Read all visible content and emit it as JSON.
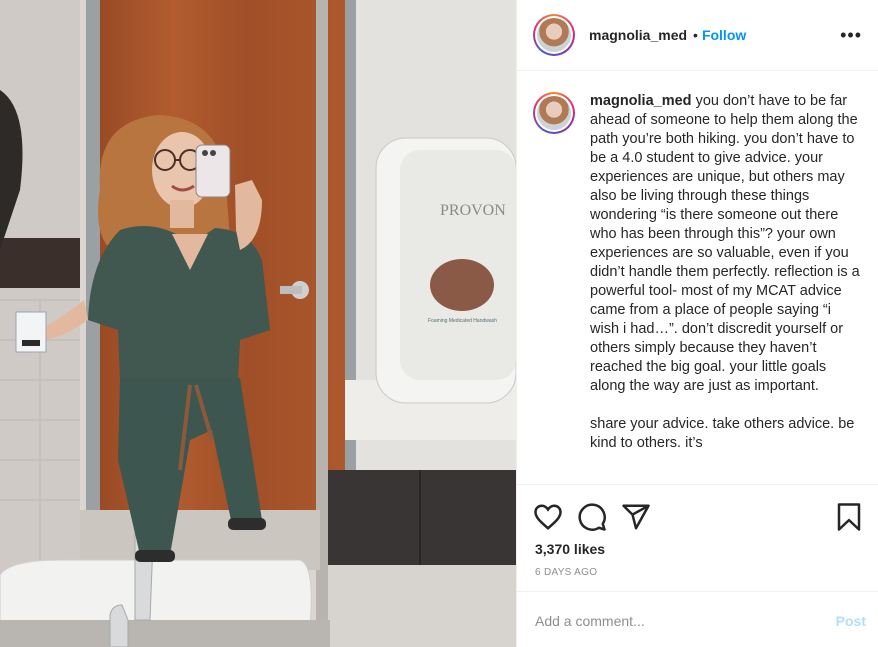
{
  "post": {
    "username": "magnolia_med",
    "follow_label": "Follow",
    "separator": "•",
    "more_icon": "more-options-icon"
  },
  "caption": {
    "username": "magnolia_med",
    "text": "you don’t have to be far ahead of someone to help them along the path you’re both hiking. you don’t have to be a 4.0 student to give advice. your experiences are unique, but others may also be living through these things wondering “is there someone out there who has been through this”? your own experiences are so valuable, even if you didn’t handle them perfectly. reflection is a powerful tool- most of my MCAT advice came from a place of people saying “i wish i had…”. don’t discredit yourself or others simply because they haven’t reached the big goal. your little goals along the way are just as important.\n\nshare your advice. take others advice. be kind to others. it’s"
  },
  "photo": {
    "dispenser_brand": "PROVON",
    "dispenser_label": "Foaming Medicated Handwash"
  },
  "actions": {
    "icons": [
      "heart-icon",
      "comment-icon",
      "share-icon",
      "bookmark-icon"
    ],
    "likes_text": "3,370 likes",
    "date_text": "6 DAYS AGO"
  },
  "comment": {
    "placeholder": "Add a comment...",
    "post_label": "Post"
  },
  "colors": {
    "follow": "#0095f6",
    "post_disabled": "#b2dffc",
    "scrubs": "#3f5650",
    "door": "#a0522d"
  }
}
